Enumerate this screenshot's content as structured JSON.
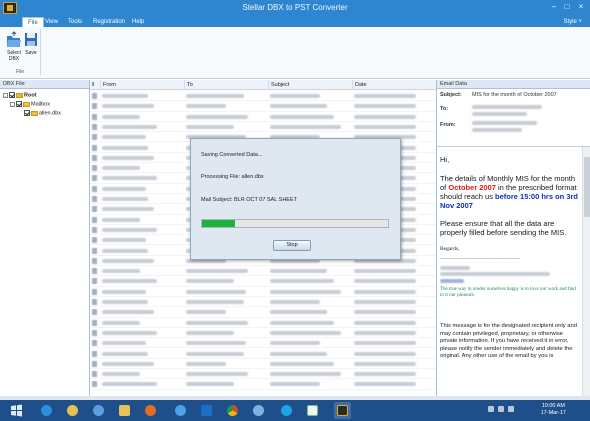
{
  "window": {
    "title": "Stellar DBX to PST Converter"
  },
  "menu": {
    "items": [
      "File",
      "View",
      "Tools",
      "Registration",
      "Help"
    ],
    "style": "Style ˅"
  },
  "ribbon": {
    "select_label": "Select DBX",
    "save_label": "Save",
    "group_label": "File"
  },
  "left_pane": {
    "title": "DBX File",
    "tree": {
      "root": "Root",
      "mailbox": "Mailbox",
      "file": "allen.dbx"
    }
  },
  "columns": {
    "from": "From",
    "to": "To",
    "subject": "Subject",
    "date": "Date"
  },
  "right_pane": {
    "title": "Email Data",
    "subject_label": "Subject:",
    "subject_value": "MIS for the month of October 2007",
    "to_label": "To:",
    "from_label": "From:",
    "body": {
      "greeting": "Hi,",
      "p1_a": "The details of Monthly MIS for the month of",
      "p1_month": "October 2007",
      "p1_b": "in the prescribed format should reach us",
      "p1_deadline": "before 15:00 hrs on 3rd Nov 2007",
      "p2": "Please ensure that all the data are properly filled before sending the MIS.",
      "regards": "Regards,",
      "divider": "------------------------------------------------",
      "motto": "The true way to render ourselves happy is to love our work and find in it our pleasure.",
      "disclaimer": "This message is for the designated recipient only and may contain privileged, proprietary, or otherwise private information. If you have received it in error, please notify the sender immediately and delete the original. Any other use of the email by you is"
    }
  },
  "dialog": {
    "status": "Saving Converted Data...",
    "processing": "Processing File:  allen.dbx",
    "mail_subject": "Mail Subject:  BLR OCT 07 SAL SHEET",
    "progress": 0.18,
    "stop_label": "Stop"
  },
  "taskbar": {
    "apps": [
      "windows-start",
      "ie",
      "paint",
      "media",
      "files",
      "firefox",
      "explorer",
      "outlook",
      "chrome",
      "network",
      "skype",
      "notepad",
      "stellar"
    ],
    "time": "10:00 AM",
    "date": "17-Mar-17"
  },
  "colors": {
    "accent": "#2e86d1",
    "progress": "#1db33a",
    "highlight_red": "#d62020",
    "highlight_blue": "#1030c0"
  }
}
